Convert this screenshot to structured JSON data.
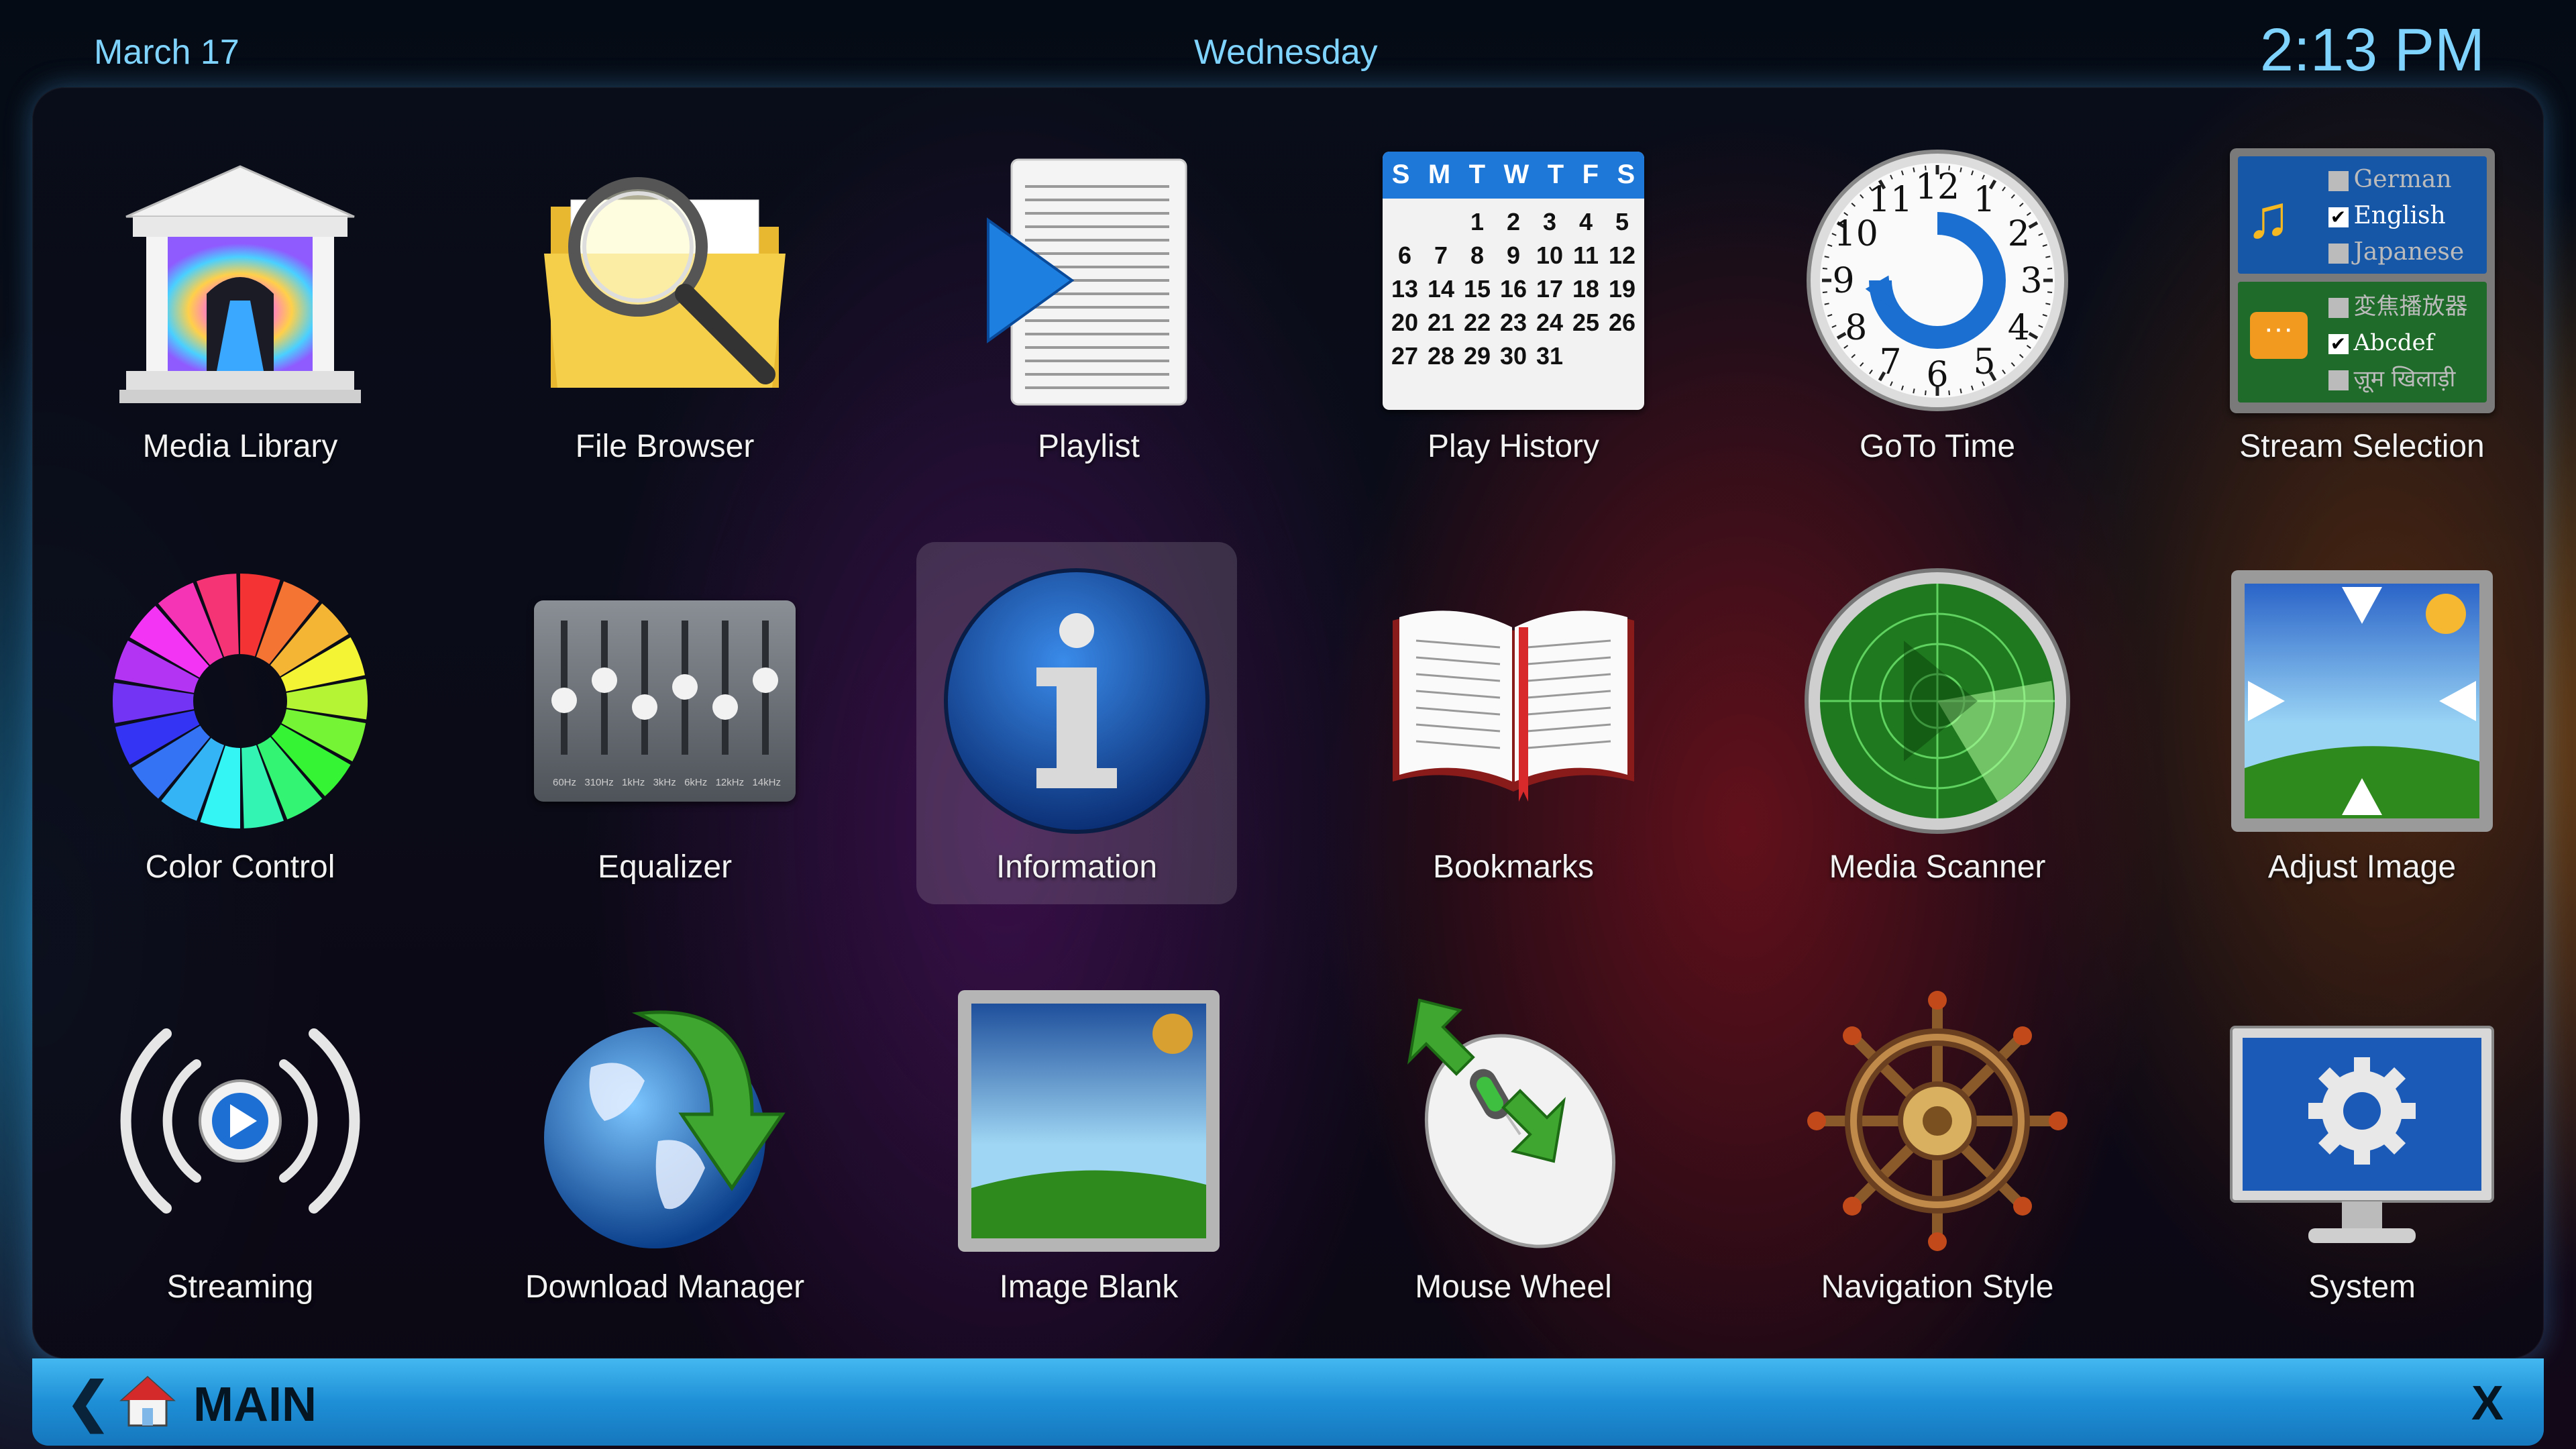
{
  "header": {
    "date": "March 17",
    "day": "Wednesday",
    "time": "2:13 PM"
  },
  "tiles": [
    {
      "label": "Media Library",
      "icon": "temple-icon"
    },
    {
      "label": "File Browser",
      "icon": "folder-magnifier-icon"
    },
    {
      "label": "Playlist",
      "icon": "playlist-icon"
    },
    {
      "label": "Play History",
      "icon": "calendar-icon"
    },
    {
      "label": "GoTo Time",
      "icon": "clock-icon"
    },
    {
      "label": "Stream Selection",
      "icon": "language-selection-icon"
    },
    {
      "label": "Color Control",
      "icon": "color-wheel-icon"
    },
    {
      "label": "Equalizer",
      "icon": "equalizer-icon"
    },
    {
      "label": "Information",
      "icon": "info-icon",
      "selected": true
    },
    {
      "label": "Bookmarks",
      "icon": "open-book-icon"
    },
    {
      "label": "Media Scanner",
      "icon": "radar-icon"
    },
    {
      "label": "Adjust Image",
      "icon": "adjust-image-icon"
    },
    {
      "label": "Streaming",
      "icon": "streaming-icon"
    },
    {
      "label": "Download Manager",
      "icon": "globe-download-icon"
    },
    {
      "label": "Image Blank",
      "icon": "image-blank-icon"
    },
    {
      "label": "Mouse Wheel",
      "icon": "mouse-icon"
    },
    {
      "label": "Navigation Style",
      "icon": "ship-wheel-icon"
    },
    {
      "label": "System",
      "icon": "monitor-gear-icon"
    }
  ],
  "calendar": {
    "weekdays": [
      "S",
      "M",
      "T",
      "W",
      "T",
      "F",
      "S"
    ],
    "rows": [
      [
        "",
        "",
        "1",
        "2",
        "3",
        "4",
        "5"
      ],
      [
        "6",
        "7",
        "8",
        "9",
        "10",
        "11",
        "12"
      ],
      [
        "13",
        "14",
        "15",
        "16",
        "17",
        "18",
        "19"
      ],
      [
        "20",
        "21",
        "22",
        "23",
        "24",
        "25",
        "26"
      ],
      [
        "27",
        "28",
        "29",
        "30",
        "31",
        "",
        ""
      ]
    ]
  },
  "clock_numbers": [
    "12",
    "1",
    "2",
    "3",
    "4",
    "5",
    "6",
    "7",
    "8",
    "9",
    "10",
    "11"
  ],
  "stream_selection": {
    "audio": [
      {
        "label": "German",
        "checked": false
      },
      {
        "label": "English",
        "checked": true
      },
      {
        "label": "Japanese",
        "checked": false
      }
    ],
    "subtitles": [
      {
        "label": "変焦播放器",
        "checked": false
      },
      {
        "label": "Abcdef",
        "checked": true
      },
      {
        "label": "ज़ूम खिलाड़ी",
        "checked": false
      }
    ]
  },
  "equalizer_bands": [
    "60Hz",
    "310Hz",
    "1kHz",
    "3kHz",
    "6kHz",
    "12kHz",
    "14kHz"
  ],
  "footer": {
    "back": "❮",
    "title": "MAIN",
    "close": "X"
  },
  "colors": {
    "accent": "#7fd4ff",
    "bar": "#1e8fd6"
  }
}
